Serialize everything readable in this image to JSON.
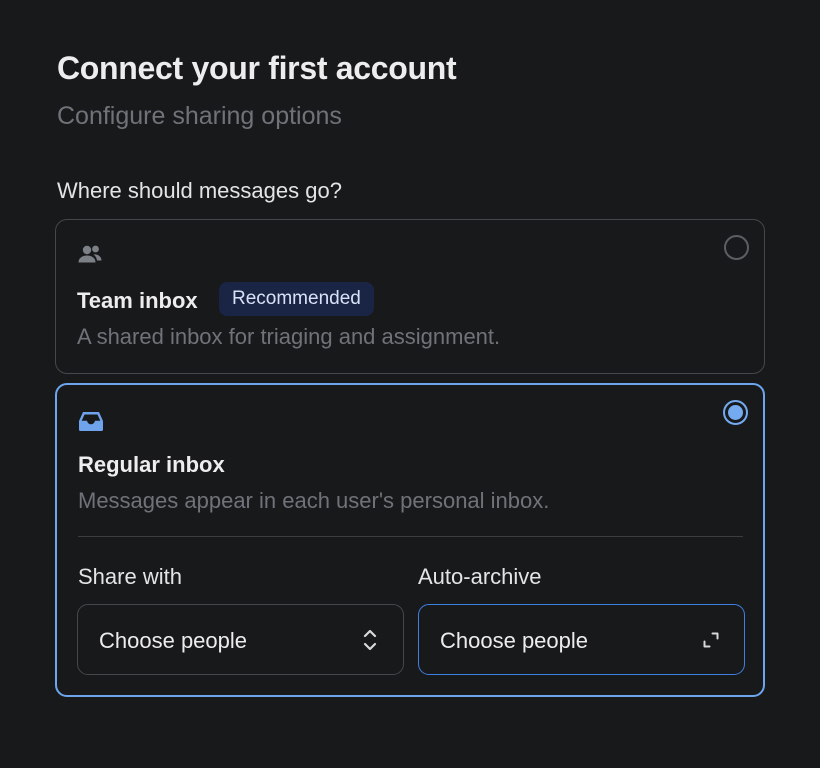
{
  "header": {
    "title": "Connect your first account",
    "subtitle": "Configure sharing options"
  },
  "question": "Where should messages go?",
  "options": [
    {
      "icon": "users-icon",
      "title": "Team inbox",
      "badge": "Recommended",
      "description": "A shared inbox for triaging and assignment.",
      "selected": false
    },
    {
      "icon": "inbox-icon",
      "title": "Regular inbox",
      "description": "Messages appear in each user's personal inbox.",
      "selected": true
    }
  ],
  "fields": {
    "share_with": {
      "label": "Share with",
      "value": "Choose people",
      "icon": "chevron-up-down-icon"
    },
    "auto_archive": {
      "label": "Auto-archive",
      "value": "Choose people",
      "icon": "expand-icon",
      "focused": true
    }
  },
  "colors": {
    "background": "#18191b",
    "accent": "#74aaf0",
    "badge_bg": "#1a2444",
    "muted_text": "#6f7379"
  }
}
